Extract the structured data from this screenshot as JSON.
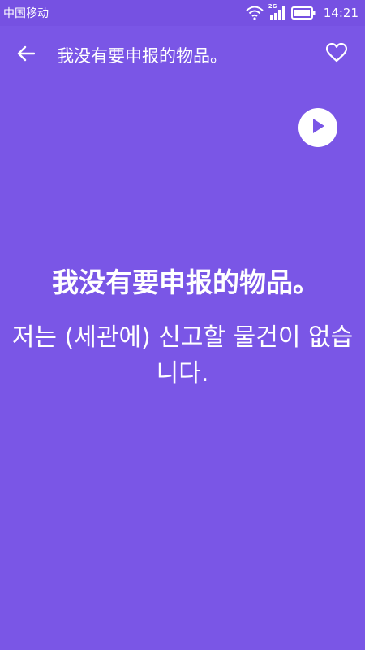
{
  "status_bar": {
    "carrier": "中国移动",
    "network_type": "2G",
    "time": "14:21",
    "icons": [
      "wifi-icon",
      "signal-icon",
      "battery-icon"
    ]
  },
  "app_bar": {
    "title": "我没有要申报的物品。",
    "back_icon": "arrow-left-icon",
    "favorite_icon": "heart-outline-icon"
  },
  "phrase": {
    "source_text": "我没有要申报的物品。",
    "translated_text": "저는 (세관에) 신고할 물건이 없습니다."
  },
  "play_icon": "play-icon",
  "colors": {
    "background": "#7a56e6",
    "status_bar": "#7651e2",
    "text": "#ffffff",
    "play_button_bg": "#ffffff",
    "play_icon": "#7a56e6"
  }
}
